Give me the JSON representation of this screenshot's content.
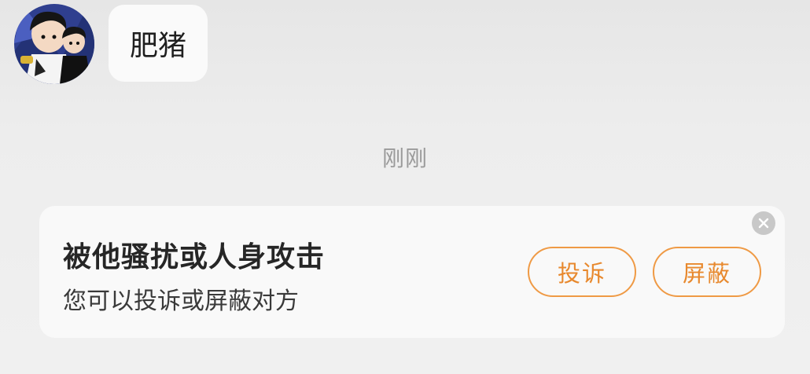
{
  "chat": {
    "message": {
      "text": "肥猪",
      "sender_avatar_icon": "cartoon-avatar-icon"
    },
    "timestamp": "刚刚"
  },
  "harassment_card": {
    "title": "被他骚扰或人身攻击",
    "subtitle": "您可以投诉或屏蔽对方",
    "report_label": "投诉",
    "block_label": "屏蔽",
    "close_icon": "close-icon",
    "accent_color": "#e8892e"
  }
}
